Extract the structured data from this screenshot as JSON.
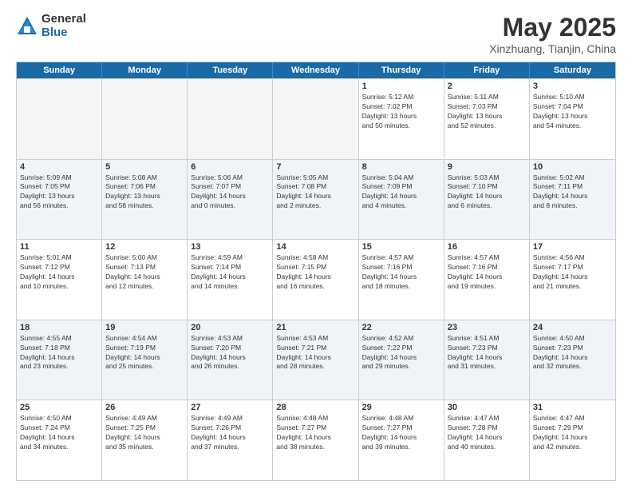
{
  "logo": {
    "general": "General",
    "blue": "Blue"
  },
  "title": "May 2025",
  "location": "Xinzhuang, Tianjin, China",
  "days": [
    "Sunday",
    "Monday",
    "Tuesday",
    "Wednesday",
    "Thursday",
    "Friday",
    "Saturday"
  ],
  "weeks": [
    [
      {
        "day": "",
        "info": "",
        "empty": true
      },
      {
        "day": "",
        "info": "",
        "empty": true
      },
      {
        "day": "",
        "info": "",
        "empty": true
      },
      {
        "day": "",
        "info": "",
        "empty": true
      },
      {
        "day": "1",
        "info": "Sunrise: 5:12 AM\nSunset: 7:02 PM\nDaylight: 13 hours\nand 50 minutes.",
        "empty": false
      },
      {
        "day": "2",
        "info": "Sunrise: 5:11 AM\nSunset: 7:03 PM\nDaylight: 13 hours\nand 52 minutes.",
        "empty": false
      },
      {
        "day": "3",
        "info": "Sunrise: 5:10 AM\nSunset: 7:04 PM\nDaylight: 13 hours\nand 54 minutes.",
        "empty": false
      }
    ],
    [
      {
        "day": "4",
        "info": "Sunrise: 5:09 AM\nSunset: 7:05 PM\nDaylight: 13 hours\nand 56 minutes.",
        "empty": false
      },
      {
        "day": "5",
        "info": "Sunrise: 5:08 AM\nSunset: 7:06 PM\nDaylight: 13 hours\nand 58 minutes.",
        "empty": false
      },
      {
        "day": "6",
        "info": "Sunrise: 5:06 AM\nSunset: 7:07 PM\nDaylight: 14 hours\nand 0 minutes.",
        "empty": false
      },
      {
        "day": "7",
        "info": "Sunrise: 5:05 AM\nSunset: 7:08 PM\nDaylight: 14 hours\nand 2 minutes.",
        "empty": false
      },
      {
        "day": "8",
        "info": "Sunrise: 5:04 AM\nSunset: 7:09 PM\nDaylight: 14 hours\nand 4 minutes.",
        "empty": false
      },
      {
        "day": "9",
        "info": "Sunrise: 5:03 AM\nSunset: 7:10 PM\nDaylight: 14 hours\nand 6 minutes.",
        "empty": false
      },
      {
        "day": "10",
        "info": "Sunrise: 5:02 AM\nSunset: 7:11 PM\nDaylight: 14 hours\nand 8 minutes.",
        "empty": false
      }
    ],
    [
      {
        "day": "11",
        "info": "Sunrise: 5:01 AM\nSunset: 7:12 PM\nDaylight: 14 hours\nand 10 minutes.",
        "empty": false
      },
      {
        "day": "12",
        "info": "Sunrise: 5:00 AM\nSunset: 7:13 PM\nDaylight: 14 hours\nand 12 minutes.",
        "empty": false
      },
      {
        "day": "13",
        "info": "Sunrise: 4:59 AM\nSunset: 7:14 PM\nDaylight: 14 hours\nand 14 minutes.",
        "empty": false
      },
      {
        "day": "14",
        "info": "Sunrise: 4:58 AM\nSunset: 7:15 PM\nDaylight: 14 hours\nand 16 minutes.",
        "empty": false
      },
      {
        "day": "15",
        "info": "Sunrise: 4:57 AM\nSunset: 7:16 PM\nDaylight: 14 hours\nand 18 minutes.",
        "empty": false
      },
      {
        "day": "16",
        "info": "Sunrise: 4:57 AM\nSunset: 7:16 PM\nDaylight: 14 hours\nand 19 minutes.",
        "empty": false
      },
      {
        "day": "17",
        "info": "Sunrise: 4:56 AM\nSunset: 7:17 PM\nDaylight: 14 hours\nand 21 minutes.",
        "empty": false
      }
    ],
    [
      {
        "day": "18",
        "info": "Sunrise: 4:55 AM\nSunset: 7:18 PM\nDaylight: 14 hours\nand 23 minutes.",
        "empty": false
      },
      {
        "day": "19",
        "info": "Sunrise: 4:54 AM\nSunset: 7:19 PM\nDaylight: 14 hours\nand 25 minutes.",
        "empty": false
      },
      {
        "day": "20",
        "info": "Sunrise: 4:53 AM\nSunset: 7:20 PM\nDaylight: 14 hours\nand 26 minutes.",
        "empty": false
      },
      {
        "day": "21",
        "info": "Sunrise: 4:53 AM\nSunset: 7:21 PM\nDaylight: 14 hours\nand 28 minutes.",
        "empty": false
      },
      {
        "day": "22",
        "info": "Sunrise: 4:52 AM\nSunset: 7:22 PM\nDaylight: 14 hours\nand 29 minutes.",
        "empty": false
      },
      {
        "day": "23",
        "info": "Sunrise: 4:51 AM\nSunset: 7:23 PM\nDaylight: 14 hours\nand 31 minutes.",
        "empty": false
      },
      {
        "day": "24",
        "info": "Sunrise: 4:50 AM\nSunset: 7:23 PM\nDaylight: 14 hours\nand 32 minutes.",
        "empty": false
      }
    ],
    [
      {
        "day": "25",
        "info": "Sunrise: 4:50 AM\nSunset: 7:24 PM\nDaylight: 14 hours\nand 34 minutes.",
        "empty": false
      },
      {
        "day": "26",
        "info": "Sunrise: 4:49 AM\nSunset: 7:25 PM\nDaylight: 14 hours\nand 35 minutes.",
        "empty": false
      },
      {
        "day": "27",
        "info": "Sunrise: 4:49 AM\nSunset: 7:26 PM\nDaylight: 14 hours\nand 37 minutes.",
        "empty": false
      },
      {
        "day": "28",
        "info": "Sunrise: 4:48 AM\nSunset: 7:27 PM\nDaylight: 14 hours\nand 38 minutes.",
        "empty": false
      },
      {
        "day": "29",
        "info": "Sunrise: 4:48 AM\nSunset: 7:27 PM\nDaylight: 14 hours\nand 39 minutes.",
        "empty": false
      },
      {
        "day": "30",
        "info": "Sunrise: 4:47 AM\nSunset: 7:28 PM\nDaylight: 14 hours\nand 40 minutes.",
        "empty": false
      },
      {
        "day": "31",
        "info": "Sunrise: 4:47 AM\nSunset: 7:29 PM\nDaylight: 14 hours\nand 42 minutes.",
        "empty": false
      }
    ]
  ]
}
